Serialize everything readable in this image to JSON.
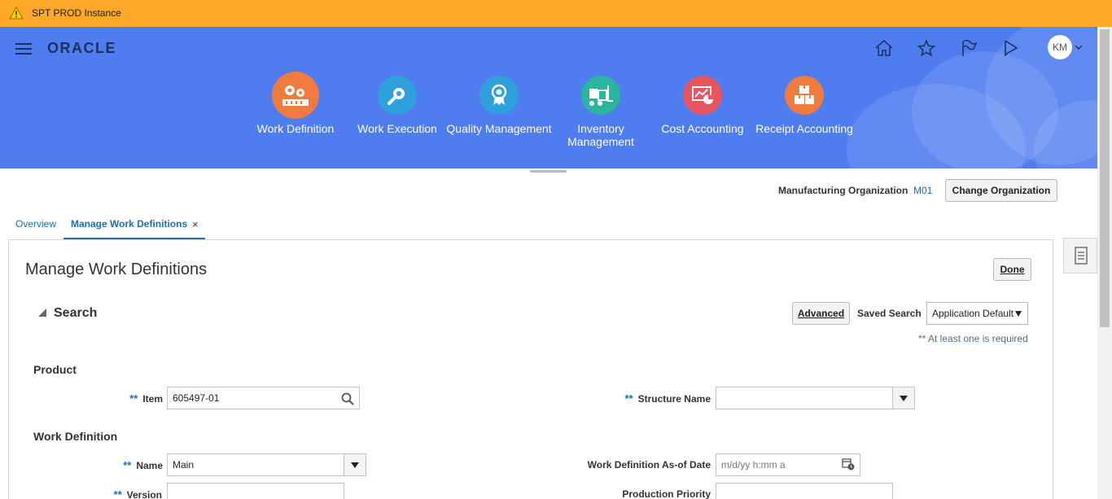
{
  "warning_bar": {
    "text": "SPT PROD Instance",
    "icon": "warning-icon",
    "color": "#fda829"
  },
  "header": {
    "logo": "ORACLE",
    "background": "#4f7df0",
    "user_initials": "KM",
    "icons": [
      "home-icon",
      "star-icon",
      "flag-icon",
      "notifications-icon"
    ]
  },
  "apps": [
    {
      "label": "Work Definition",
      "color": "#f07b3f",
      "icon": "gears-icon"
    },
    {
      "label": "Work Execution",
      "color": "#2ea0db",
      "icon": "wrench-gear-icon"
    },
    {
      "label": "Quality Management",
      "color": "#2ea0db",
      "icon": "ribbon-icon"
    },
    {
      "label": "Inventory Management",
      "color": "#2bb59c",
      "icon": "forklift-icon"
    },
    {
      "label": "Cost Accounting",
      "color": "#e9555f",
      "icon": "cost-chart-icon"
    },
    {
      "label": "Receipt Accounting",
      "color": "#f07b3f",
      "icon": "boxes-icon"
    }
  ],
  "org": {
    "label": "Manufacturing Organization",
    "value": "M01",
    "change_button": "Change Organization"
  },
  "tabs": [
    {
      "label": "Overview",
      "active": false
    },
    {
      "label": "Manage Work Definitions",
      "active": true,
      "close": "×"
    }
  ],
  "page": {
    "title": "Manage Work Definitions",
    "done_button": "Done"
  },
  "search": {
    "title": "Search",
    "advanced_button": "Advanced",
    "saved_search_label": "Saved Search",
    "saved_search_value": "Application Default",
    "required_note": "** At least one is required",
    "required_marker": "**"
  },
  "product": {
    "section": "Product",
    "item_label": "Item",
    "item_value": "605497-01",
    "structure_label": "Structure Name",
    "structure_value": ""
  },
  "work_definition": {
    "section": "Work Definition",
    "name_label": "Name",
    "name_value": "Main",
    "asof_label": "Work Definition As-of Date",
    "asof_placeholder": "m/d/yy h:mm a",
    "version_label": "Version",
    "version_value": "",
    "priority_label": "Production Priority",
    "priority_value": ""
  }
}
